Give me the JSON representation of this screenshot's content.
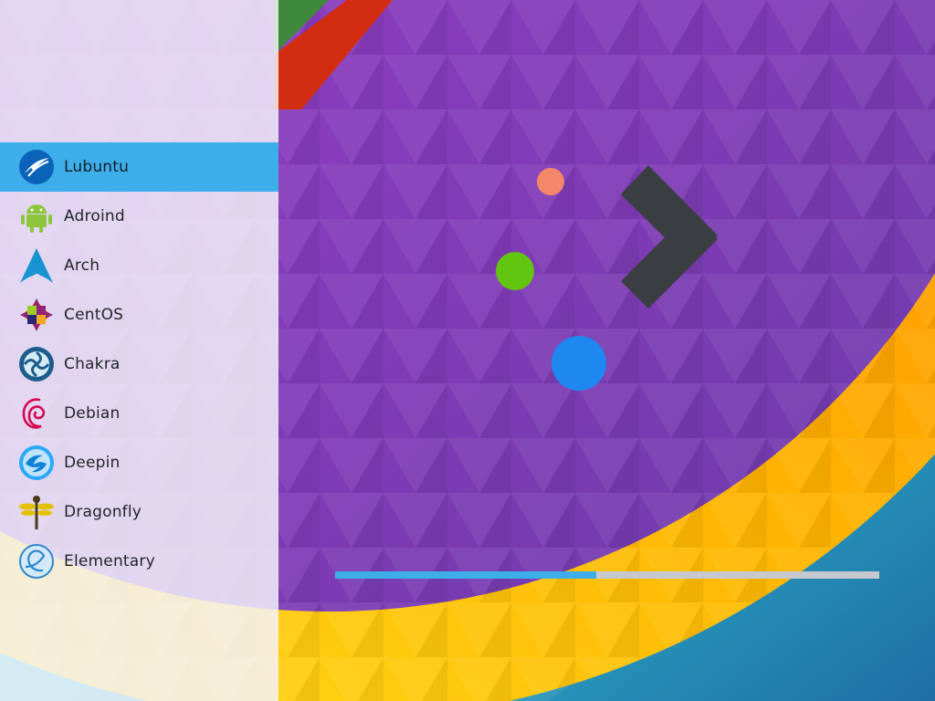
{
  "distros": [
    {
      "label": "Lubuntu",
      "icon": "lubuntu-icon",
      "selected": true
    },
    {
      "label": "Adroind",
      "icon": "android-icon",
      "selected": false
    },
    {
      "label": "Arch",
      "icon": "arch-icon",
      "selected": false
    },
    {
      "label": "CentOS",
      "icon": "centos-icon",
      "selected": false
    },
    {
      "label": "Chakra",
      "icon": "chakra-icon",
      "selected": false
    },
    {
      "label": "Debian",
      "icon": "debian-icon",
      "selected": false
    },
    {
      "label": "Deepin",
      "icon": "deepin-icon",
      "selected": false
    },
    {
      "label": "Dragonfly",
      "icon": "dragonfly-icon",
      "selected": false
    },
    {
      "label": "Elementary",
      "icon": "elementary-icon",
      "selected": false
    }
  ],
  "progress": {
    "fraction": 0.48
  },
  "colors": {
    "accent": "#3daee9",
    "dot_salmon": "#f4876a",
    "dot_green": "#62c50f",
    "dot_blue": "#1e88f0",
    "chevron": "#3a3e42"
  }
}
